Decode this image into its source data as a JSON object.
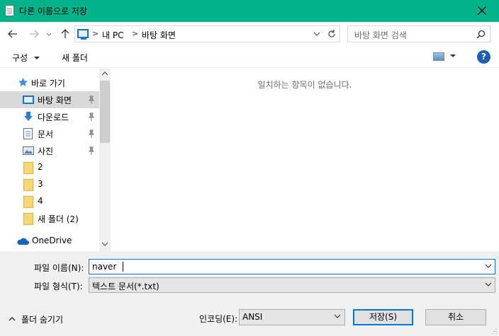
{
  "window": {
    "title": "다른 이름으로 저장"
  },
  "address": {
    "crumbs": [
      "내 PC",
      "바탕 화면"
    ]
  },
  "search": {
    "placeholder": "바탕 화면 검색"
  },
  "toolbar": {
    "organize_label": "구성",
    "new_folder_label": "새 폴더",
    "help_label": "?"
  },
  "sidebar": {
    "items": [
      {
        "label": "바로 가기",
        "icon": "star-icon"
      },
      {
        "label": "바탕 화면",
        "icon": "desktop-icon",
        "selected": true,
        "pinned": true
      },
      {
        "label": "다운로드",
        "icon": "download-icon",
        "pinned": true
      },
      {
        "label": "문서",
        "icon": "document-icon",
        "pinned": true
      },
      {
        "label": "사진",
        "icon": "picture-icon",
        "pinned": true
      },
      {
        "label": "2",
        "icon": "folder-icon"
      },
      {
        "label": "3",
        "icon": "folder-icon"
      },
      {
        "label": "4",
        "icon": "folder-icon"
      },
      {
        "label": "새 폴더 (2)",
        "icon": "folder-icon"
      },
      {
        "label": "OneDrive",
        "icon": "cloud-icon"
      }
    ]
  },
  "content": {
    "empty_message": "일치하는 항목이 없습니다."
  },
  "form": {
    "filename_label": "파일 이름(N):",
    "filename_value": "naver",
    "filetype_label": "파일 형식(T):",
    "filetype_value": "텍스트 문서(*.txt)",
    "encoding_label": "인코딩(E):",
    "encoding_value": "ANSI",
    "hide_folders_label": "폴더 숨기기",
    "save_label": "저장(S)",
    "cancel_label": "취소"
  },
  "colors": {
    "titlebar": "#00b38a",
    "selection": "#d9d9d9",
    "focus": "#0078d7"
  }
}
